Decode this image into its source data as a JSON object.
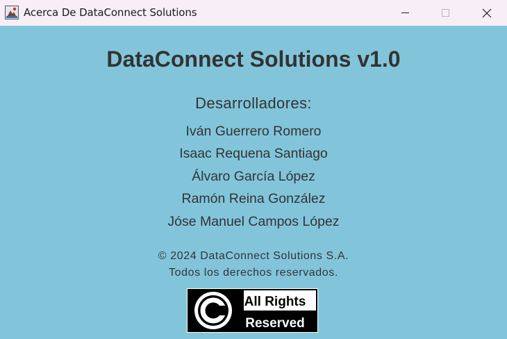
{
  "window": {
    "title": "Acerca De DataConnect Solutions"
  },
  "about": {
    "heading": "DataConnect Solutions v1.0",
    "developers_label": "Desarrolladores:",
    "developers": [
      "Iván Guerrero Romero",
      "Isaac Requena Santiago",
      "Álvaro García López",
      "Ramón Reina González",
      "Jóse Manuel Campos López"
    ],
    "copyright": "© 2024 DataConnect Solutions S.A.",
    "rights": "Todos los derechos reservados."
  },
  "badge": {
    "line1": "All Rights",
    "line2": "Reserved",
    "icon": "copyright-icon"
  },
  "colors": {
    "background": "#82c5da",
    "text": "#333333",
    "titlebar": "#f7eef8"
  }
}
